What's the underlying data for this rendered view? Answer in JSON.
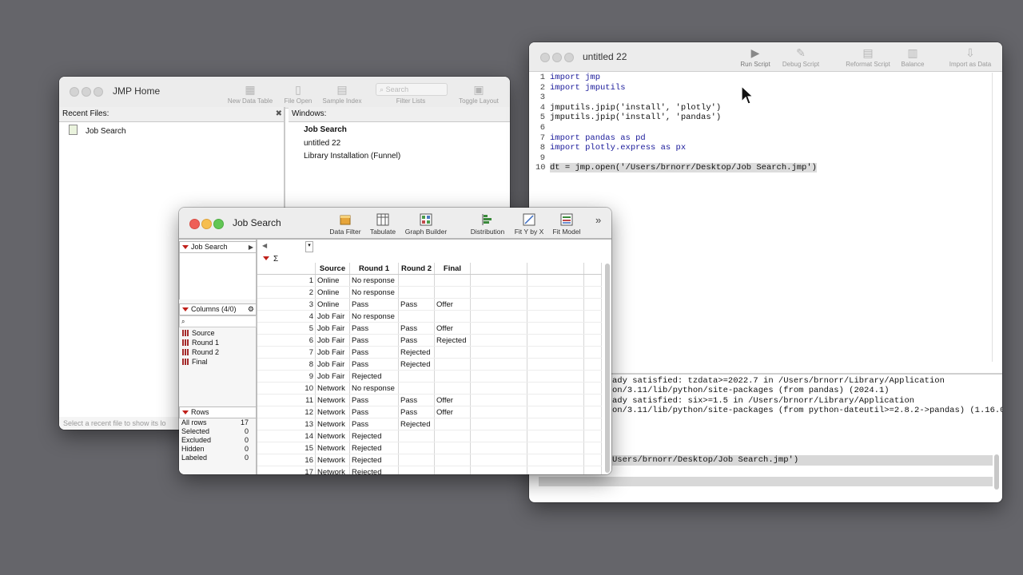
{
  "home": {
    "title": "JMP Home",
    "toolbar": [
      "New Data Table",
      "File Open",
      "Sample Index",
      "Filter Lists",
      "Toggle Layout"
    ],
    "search_placeholder": "Search",
    "recent_header": "Recent Files:",
    "recent_files": [
      "Job Search"
    ],
    "windows_header": "Windows:",
    "windows": [
      "Job Search",
      "untitled 22",
      "Library Installation (Funnel)"
    ],
    "status": "Select a recent file to show its lo"
  },
  "script": {
    "title": "untitled 22",
    "toolbar": [
      "Run Script",
      "Debug Script",
      "Reformat Script",
      "Balance",
      "Import as Data"
    ],
    "code": [
      {
        "n": "1",
        "t": "import jmp"
      },
      {
        "n": "2",
        "t": "import jmputils"
      },
      {
        "n": "3",
        "t": ""
      },
      {
        "n": "4",
        "t": "jmputils.jpip('install', 'plotly')"
      },
      {
        "n": "5",
        "t": "jmputils.jpip('install', 'pandas')"
      },
      {
        "n": "6",
        "t": ""
      },
      {
        "n": "7",
        "t": "import pandas as pd"
      },
      {
        "n": "8",
        "t": "import plotly.express as px"
      },
      {
        "n": "9",
        "t": ""
      },
      {
        "n": "10",
        "t": "dt = jmp.open('/Users/brnorr/Desktop/Job Search.jmp')"
      }
    ],
    "log": [
      "ady satisfied: tzdata>=2022.7 in /Users/brnorr/Library/Application",
      "on/3.11/lib/python/site-packages (from pandas) (2024.1)",
      "ady satisfied: six>=1.5 in /Users/brnorr/Library/Application",
      "on/3.11/lib/python/site-packages (from python-dateutil>=2.8.2->pandas) (1.16.0)",
      "Users/brnorr/Desktop/Job Search.jmp')"
    ]
  },
  "jobs": {
    "title": "Job Search",
    "toolbar": [
      "Data Filter",
      "Tabulate",
      "Graph Builder",
      "Distribution",
      "Fit Y by X",
      "Fit Model"
    ],
    "table_panel": "Job Search",
    "columns_header": "Columns (4/0)",
    "columns": [
      "Source",
      "Round 1",
      "Round 2",
      "Final"
    ],
    "rows_header": "Rows",
    "row_stats": [
      {
        "label": "All rows",
        "value": "17"
      },
      {
        "label": "Selected",
        "value": "0"
      },
      {
        "label": "Excluded",
        "value": "0"
      },
      {
        "label": "Hidden",
        "value": "0"
      },
      {
        "label": "Labeled",
        "value": "0"
      }
    ],
    "headers": [
      "Source",
      "Round 1",
      "Round 2",
      "Final"
    ],
    "rows": [
      [
        "1",
        "Online",
        "No response",
        "",
        ""
      ],
      [
        "2",
        "Online",
        "No response",
        "",
        ""
      ],
      [
        "3",
        "Online",
        "Pass",
        "Pass",
        "Offer"
      ],
      [
        "4",
        "Job Fair",
        "No response",
        "",
        ""
      ],
      [
        "5",
        "Job Fair",
        "Pass",
        "Pass",
        "Offer"
      ],
      [
        "6",
        "Job Fair",
        "Pass",
        "Pass",
        "Rejected"
      ],
      [
        "7",
        "Job Fair",
        "Pass",
        "Rejected",
        ""
      ],
      [
        "8",
        "Job Fair",
        "Pass",
        "Rejected",
        ""
      ],
      [
        "9",
        "Job Fair",
        "Rejected",
        "",
        ""
      ],
      [
        "10",
        "Network",
        "No response",
        "",
        ""
      ],
      [
        "11",
        "Network",
        "Pass",
        "Pass",
        "Offer"
      ],
      [
        "12",
        "Network",
        "Pass",
        "Pass",
        "Offer"
      ],
      [
        "13",
        "Network",
        "Pass",
        "Rejected",
        ""
      ],
      [
        "14",
        "Network",
        "Rejected",
        "",
        ""
      ],
      [
        "15",
        "Network",
        "Rejected",
        "",
        ""
      ],
      [
        "16",
        "Network",
        "Rejected",
        "",
        ""
      ],
      [
        "17",
        "Network",
        "Rejected",
        "",
        ""
      ]
    ]
  }
}
